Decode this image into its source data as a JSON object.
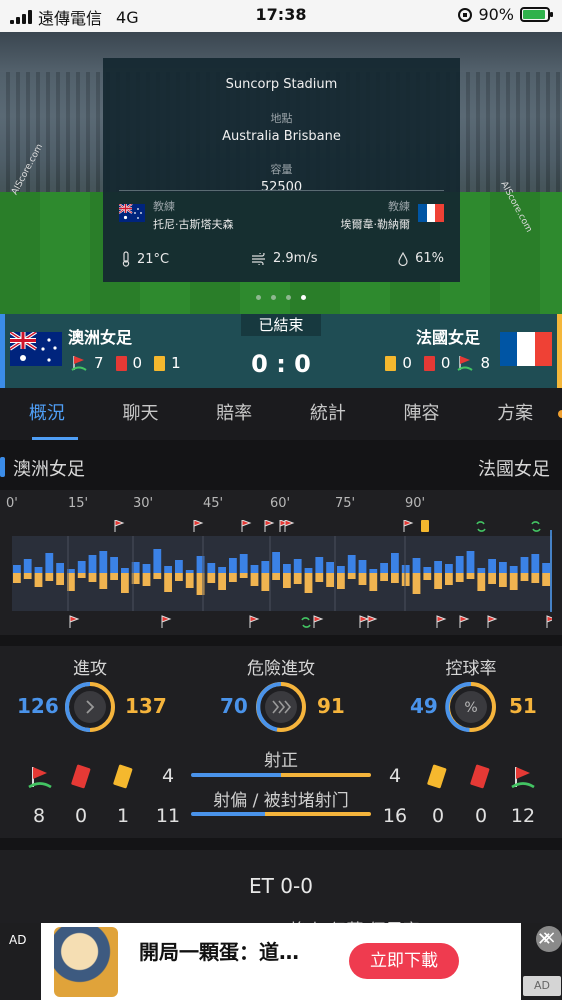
{
  "status_bar": {
    "carrier": "遠傳電信",
    "network": "4G",
    "time": "17:38",
    "battery": "90%",
    "battery_level": 0.9
  },
  "venue": {
    "stadium": "Suncorp Stadium",
    "location_label": "地點",
    "location": "Australia  Brisbane",
    "capacity_label": "容量",
    "capacity": "52500",
    "coach_label": "教練",
    "home_coach": "托尼·古斯塔夫森",
    "away_coach": "埃爾韋·勒納爾",
    "temperature": "21°C",
    "wind": "2.9m/s",
    "humidity": "61%",
    "sidebanner": "AIScore.com",
    "pages": 4,
    "active_page": 4
  },
  "match": {
    "status": "已結束",
    "home_team": "澳洲女足",
    "away_team": "法國女足",
    "score": "0 : 0",
    "home": {
      "corners": "7",
      "red": "0",
      "yellow": "1"
    },
    "away": {
      "yellow": "0",
      "red": "0",
      "corners": "8"
    }
  },
  "tabs": [
    "概況",
    "聊天",
    "賠率",
    "統計",
    "陣容",
    "方案"
  ],
  "teams_row": {
    "home": "澳洲女足",
    "away": "法國女足"
  },
  "timeline": {
    "ticks": [
      "0'",
      "15'",
      "30'",
      "45'",
      "60'",
      "75'",
      "90'"
    ]
  },
  "stats": {
    "attack": {
      "label": "進攻",
      "home": "126",
      "away": "137"
    },
    "dangerous_attack": {
      "label": "危險進攻",
      "home": "70",
      "away": "91"
    },
    "possession": {
      "label": "控球率",
      "home": "49",
      "away": "51",
      "symbol": "%"
    },
    "on_target": {
      "label": "射正",
      "home": "4",
      "away": "4"
    },
    "off_target": {
      "label": "射偏 / 被封堵射门",
      "home": "11",
      "away": "16"
    },
    "home_icons": {
      "corners": "8",
      "red": "0",
      "yellow": "1"
    },
    "away_icons": {
      "yellow": "0",
      "red": "0",
      "corners": "12"
    }
  },
  "et": {
    "title": "ET 0-0",
    "partial_text": "换上 伊莉 個里塞"
  },
  "ad": {
    "label": "AD",
    "text": "開局一顆蛋：道…",
    "cta": "立即下載",
    "tag": "AD"
  },
  "colors": {
    "home": "#3b8ce8",
    "away": "#f4b73a",
    "accent": "#4f9ef5"
  }
}
